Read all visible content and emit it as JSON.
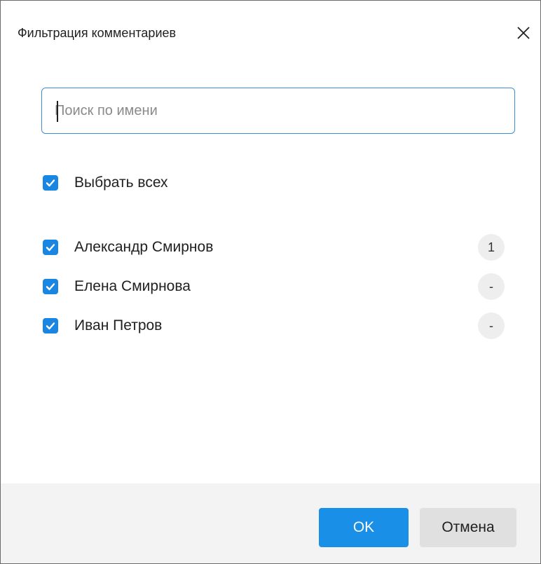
{
  "dialog": {
    "title": "Фильтрация комментариев",
    "close_icon": "close-icon"
  },
  "search": {
    "value": "",
    "placeholder": "Поиск по имени"
  },
  "select_all": {
    "label": "Выбрать всех",
    "checked": true
  },
  "users": [
    {
      "name": "Александр Смирнов",
      "checked": true,
      "count": "1"
    },
    {
      "name": "Елена Смирнова",
      "checked": true,
      "count": "-"
    },
    {
      "name": "Иван Петров",
      "checked": true,
      "count": "-"
    }
  ],
  "footer": {
    "ok_label": "OK",
    "cancel_label": "Отмена"
  },
  "colors": {
    "accent": "#1a86e3",
    "ok_button": "#1a8fe8",
    "footer_bg": "#f3f3f3",
    "badge_bg": "#eeeeee"
  }
}
